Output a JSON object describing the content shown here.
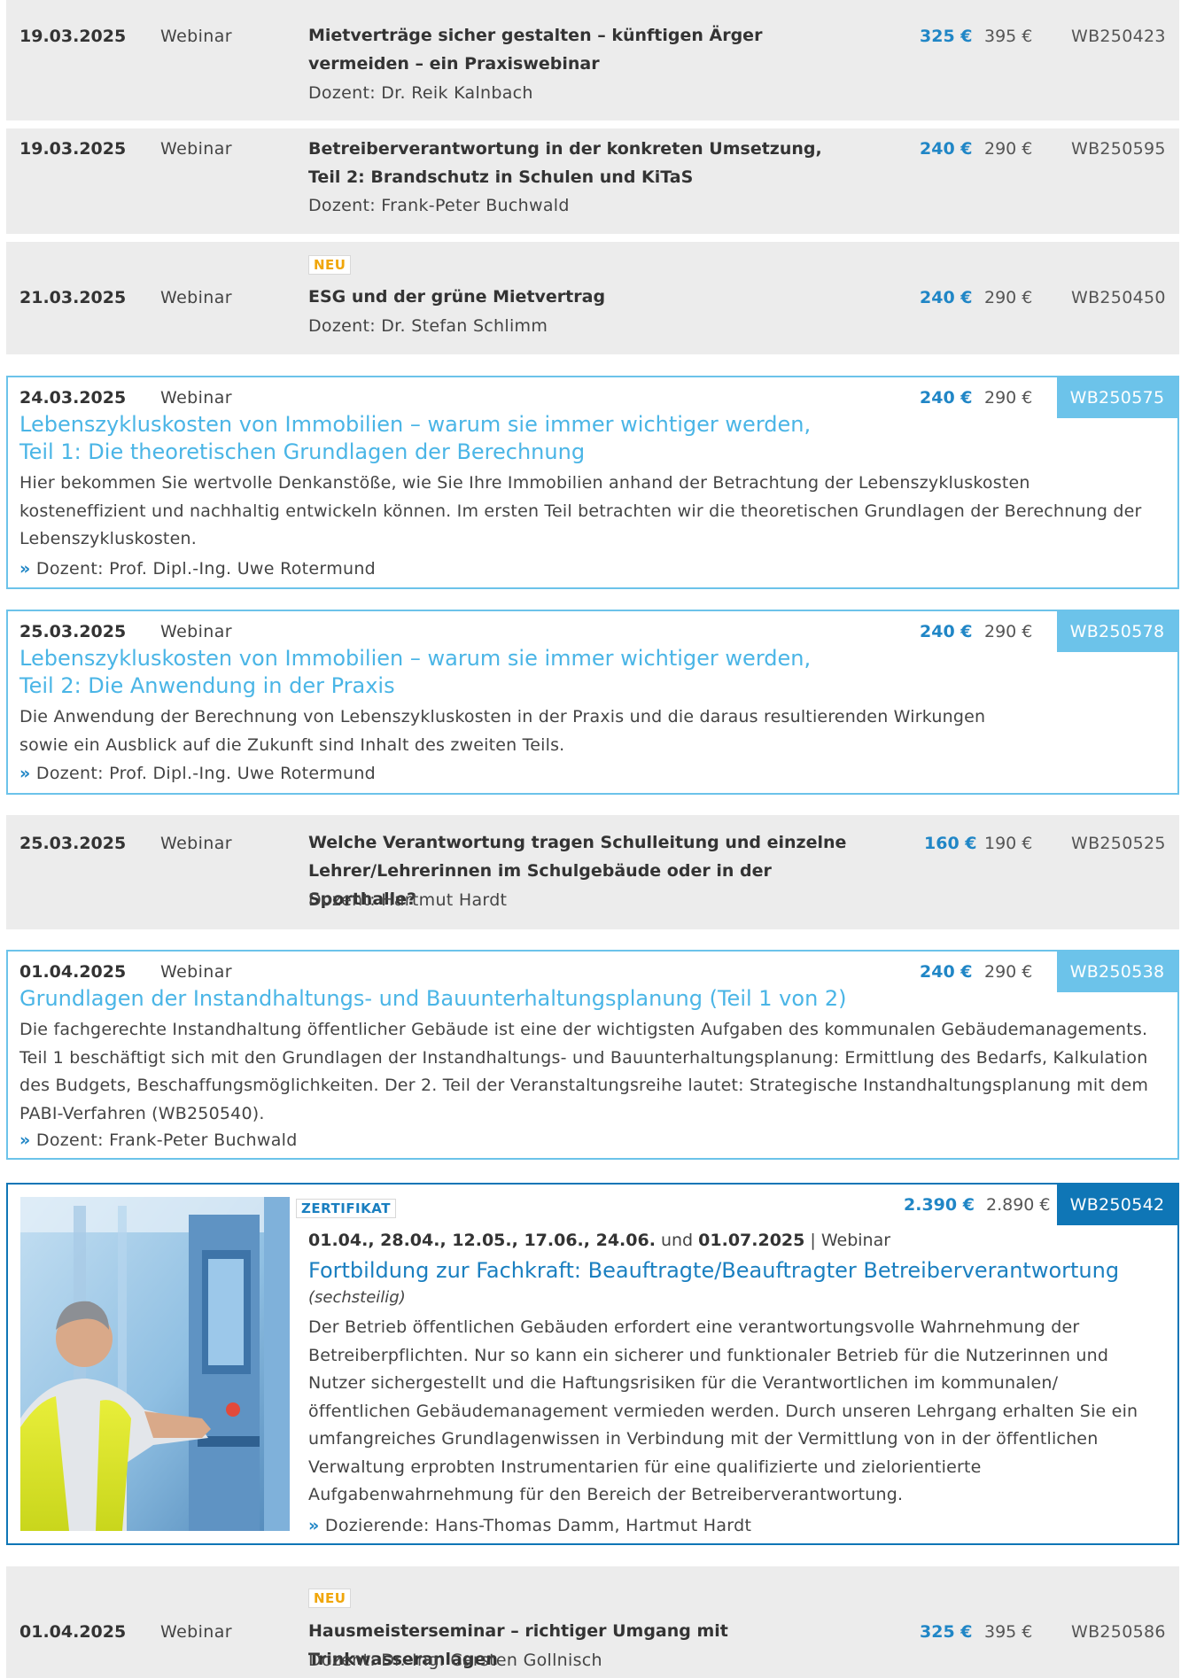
{
  "rows": [
    {
      "date": "19.03.2025",
      "type": "Webinar",
      "title": "Mietverträge sicher gestalten – künftigen Ärger vermeiden – ein Praxiswebinar",
      "lecturer": "Dozent: Dr. Reik Kalnbach",
      "price": "325 €",
      "old_price": "395 €",
      "code": "WB250423"
    },
    {
      "date": "19.03.2025",
      "type": "Webinar",
      "title": "Betreiberverantwortung in der konkreten Umsetzung, Teil 2: Brandschutz in Schulen und KiTaS",
      "lecturer": "Dozent: Frank-Peter Buchwald",
      "price": "240 €",
      "old_price": "290 €",
      "code": "WB250595"
    },
    {
      "date": "21.03.2025",
      "type": "Webinar",
      "badge": "NEU",
      "title": "ESG und der grüne Mietvertrag",
      "lecturer": "Dozent: Dr. Stefan Schlimm",
      "price": "240 €",
      "old_price": "290 €",
      "code": "WB250450"
    },
    {
      "date": "24.03.2025",
      "type": "Webinar",
      "title_l1": "Lebenszykluskosten von Immobilien – warum sie immer wichtiger werden,",
      "title_l2": "Teil 1: Die theoretischen Grundlagen der Berechnung",
      "desc": "Hier bekommen Sie wertvolle Denkanstöße, wie Sie Ihre Immobilien anhand der Betrachtung der Lebenszykluskosten kosteneffizient und nachhaltig entwickeln können. Im ersten Teil betrachten wir die theoretischen Grundlagen der Berechnung der Lebenszykluskosten.",
      "arrow": "»",
      "lecturer": "Dozent: Prof. Dipl.-Ing. Uwe Rotermund",
      "price": "240 €",
      "old_price": "290 €",
      "code": "WB250575"
    },
    {
      "date": "25.03.2025",
      "type": "Webinar",
      "title_l1": "Lebenszykluskosten von Immobilien – warum sie immer wichtiger werden,",
      "title_l2": "Teil 2: Die Anwendung in der Praxis",
      "desc": "Die Anwendung der Berechnung von Lebenszykluskosten in der Praxis und die daraus resultierenden Wirkungen sowie ein Ausblick auf die Zukunft sind Inhalt des zweiten Teils.",
      "arrow": "»",
      "lecturer": "Dozent: Prof. Dipl.-Ing. Uwe Rotermund",
      "price": "240 €",
      "old_price": "290 €",
      "code": "WB250578"
    },
    {
      "date": "25.03.2025",
      "type": "Webinar",
      "title": "Welche Verantwortung tragen Schulleitung und einzelne Lehrer/Lehrerinnen im Schulgebäude oder in der Sporthalle?",
      "lecturer": "Dozent: Hartmut Hardt",
      "price": "160 €",
      "old_price": "190 €",
      "code": "WB250525"
    },
    {
      "date": "01.04.2025",
      "type": "Webinar",
      "title": "Grundlagen der Instandhaltungs- und Bauunterhaltungsplanung (Teil 1 von 2)",
      "desc": "Die fachgerechte Instandhaltung öffentlicher Gebäude ist eine der wichtigsten Aufgaben des kommunalen Gebäudemanagements. Teil 1 beschäftigt sich mit den Grundlagen der Instandhaltungs- und Bauunterhaltungsplanung: Ermittlung des Bedarfs, Kalkulation des Budgets, Beschaffungsmöglichkeiten. Der 2. Teil der Veranstaltungsreihe lautet: Strategische Instandhaltungsplanung mit dem PABI-Verfahren (WB250540).",
      "arrow": "»",
      "lecturer": "Dozent: Frank-Peter Buchwald",
      "price": "240 €",
      "old_price": "290 €",
      "code": "WB250538"
    },
    {
      "badge": "ZERTIFIKAT",
      "dates_bold": "01.04., 28.04., 12.05., 17.06., 24.06.",
      "dates_and": " und ",
      "dates_bold2": "01.07.2025",
      "dates_sep": " | ",
      "type": "Webinar",
      "title": "Fortbildung zur Fachkraft: Beauftragte/Beauftragter Betreiberverantwortung",
      "subtitle": "(sechsteilig)",
      "desc": "Der Betrieb öffentlichen Gebäuden erfordert eine verantwortungsvolle Wahrnehmung der Betreiberpflichten. Nur so kann ein sicherer und funktionaler Betrieb für die Nutzerinnen und Nutzer sichergestellt und die Haftungsrisiken für die Verantwortlichen im kommunalen/öffentlichen Gebäudemanagement vermieden werden. Durch unseren Lehrgang erhalten Sie ein umfangreiches Grundlagenwissen in Verbindung mit der Vermittlung von in der öffentlichen Verwaltung erprobten Instrumentarien für eine qualifizierte und zielorientierte Aufgabenwahrnehmung für den Bereich der Betreiberverantwortung.",
      "arrow": "»",
      "lecturer": "Dozierende: Hans-Thomas Damm, Hartmut Hardt",
      "price": "2.390 €",
      "old_price": "2.890 €",
      "code": "WB250542"
    },
    {
      "date": "01.04.2025",
      "type": "Webinar",
      "badge": "NEU",
      "title": "Hausmeisterseminar – richtiger Umgang mit Trinkwasseranlagen",
      "lecturer": "Dozent: Dr.-Ing. Carsten Gollnisch",
      "price": "325 €",
      "old_price": "395 €",
      "code": "WB250586"
    }
  ],
  "colors": {
    "accent": "#4ab5e6",
    "price_blue": "#2086c6",
    "code_box": "#6cc3ea",
    "code_box_dark": "#0f76b6",
    "neu_badge": "#f0a60a",
    "grey_row": "#ececec"
  }
}
